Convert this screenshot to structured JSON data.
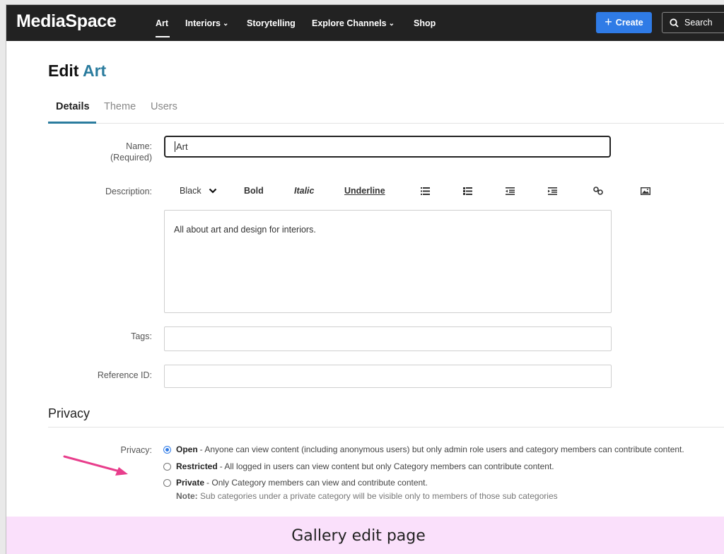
{
  "header": {
    "brand": "MediaSpace",
    "nav": [
      {
        "label": "Art",
        "dropdown": false
      },
      {
        "label": "Interiors",
        "dropdown": true
      },
      {
        "label": "Storytelling",
        "dropdown": false
      },
      {
        "label": "Explore Channels",
        "dropdown": true
      },
      {
        "label": "Shop",
        "dropdown": false
      }
    ],
    "create_label": "Create",
    "search_placeholder": "Search"
  },
  "page": {
    "title_prefix": "Edit",
    "title_name": "Art"
  },
  "tabs": [
    "Details",
    "Theme",
    "Users"
  ],
  "form": {
    "name_label": "Name:",
    "name_required": "(Required)",
    "name_value": "Art",
    "description_label": "Description:",
    "toolbar": {
      "color": "Black",
      "bold": "Bold",
      "italic": "Italic",
      "underline": "Underline"
    },
    "description_value": "All about art and design for interiors.",
    "tags_label": "Tags:",
    "tags_value": "",
    "refid_label": "Reference ID:",
    "refid_value": ""
  },
  "privacy": {
    "section_title": "Privacy",
    "label": "Privacy:",
    "options": [
      {
        "name": "Open",
        "desc": "- Anyone can view content (including anonymous users) but only admin role users and category members can contribute content.",
        "checked": true
      },
      {
        "name": "Restricted",
        "desc": "- All logged in users can view content but only Category members can contribute content.",
        "checked": false
      },
      {
        "name": "Private",
        "desc": "- Only Category members can view and contribute content.",
        "checked": false
      }
    ],
    "note_label": "Note:",
    "note_text": "Sub categories under a private category will be visible only to members of those sub categories"
  },
  "caption": "Gallery edit page",
  "colors": {
    "accent": "#2b7c9e",
    "create_button": "#2f7be6",
    "topbar": "#222222",
    "arrow": "#e83e8c",
    "caption_bg": "#fae0fb"
  }
}
